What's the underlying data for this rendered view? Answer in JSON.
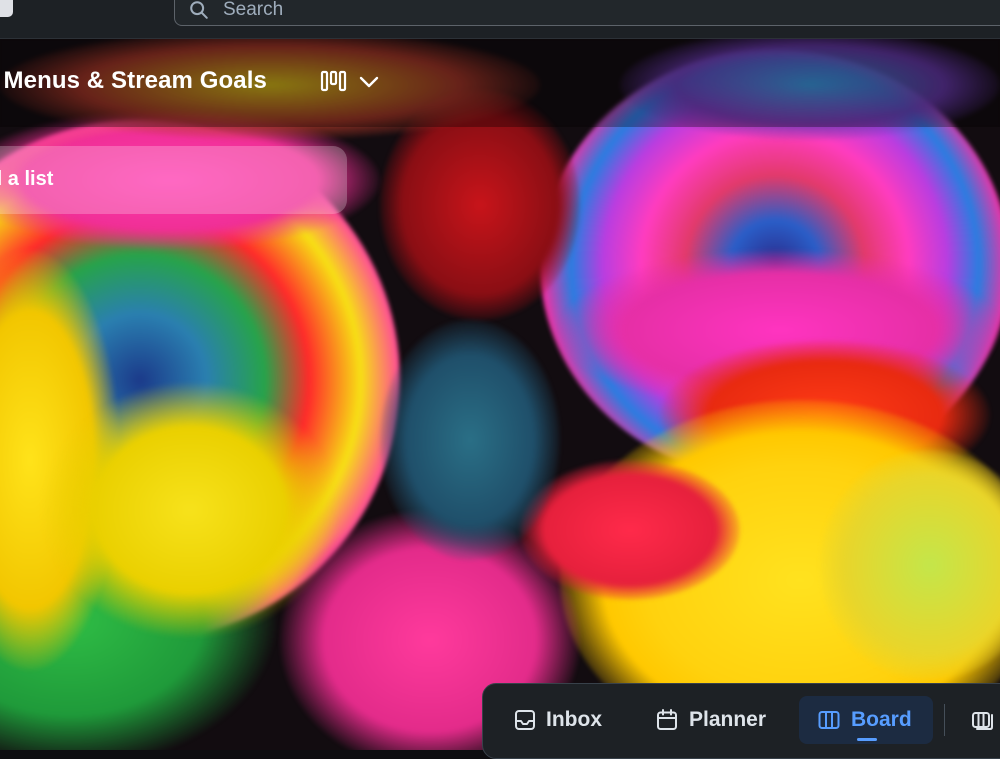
{
  "search": {
    "placeholder": "Search"
  },
  "board": {
    "title": "o Menus & Stream Goals"
  },
  "add_list": {
    "label": "d a list"
  },
  "view_switcher": {
    "icon": "board-icon",
    "chevron": "chevron-down-icon"
  },
  "bottom_nav": {
    "items": [
      {
        "label": "Inbox",
        "icon": "inbox-icon"
      },
      {
        "label": "Planner",
        "icon": "calendar-icon"
      },
      {
        "label": "Board",
        "icon": "board-icon",
        "active": true
      },
      {
        "label": "",
        "icon": "switch-boards-icon"
      }
    ]
  },
  "colors": {
    "accent": "#579dff",
    "topbar_bg": "#1d2125",
    "nav_active_bg": "#1c2b41"
  }
}
